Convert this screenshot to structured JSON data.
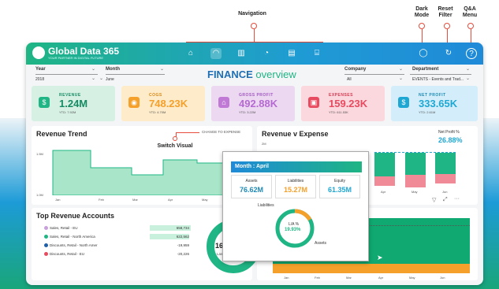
{
  "callouts": {
    "navigation": "Navigation",
    "dark_mode": "Dark Mode",
    "reset_filter": "Reset Filter",
    "qa_menu": "Q&A Menu",
    "switch_visual": "Switch Visual"
  },
  "brand": {
    "name": "Global Data 365",
    "tagline": "YOUR PARTNER IN DIGITAL FUTURE"
  },
  "colors": {
    "green": "#1fb584",
    "blue": "#1f8ad8",
    "orange": "#f5a02b"
  },
  "nav_icons": [
    "home-icon",
    "gauge-icon",
    "bar-chart-icon",
    "pie-chart-icon",
    "grid-icon",
    "bank-icon"
  ],
  "top_right_icons": [
    "bulb-icon",
    "refresh-icon",
    "question-icon"
  ],
  "filters": {
    "year": {
      "label": "Year",
      "value": "2018"
    },
    "month": {
      "label": "Month",
      "value": "June"
    },
    "company": {
      "label": "Company",
      "value": "All"
    },
    "department": {
      "label": "Department",
      "value": "EVENTS - Events and Trad..."
    }
  },
  "title": {
    "part1": "FINANCE",
    "part2": "overview"
  },
  "kpis": [
    {
      "title": "REVENUE",
      "value": "1.24M",
      "ytd": "YTD: 7.92M",
      "icon": "money-bag-icon"
    },
    {
      "title": "COGS",
      "value": "748.23K",
      "ytd": "YTD: 4.70M",
      "icon": "coin-icon"
    },
    {
      "title": "GROSS PROFIT",
      "value": "492.88K",
      "ytd": "YTD: 3.22M",
      "icon": "home-money-icon"
    },
    {
      "title": "EXPENSES",
      "value": "159.23K",
      "ytd": "YTD: 611.53K",
      "icon": "wallet-icon"
    },
    {
      "title": "NET PROFIT",
      "value": "333.65K",
      "ytd": "YTD: 2.61M",
      "icon": "dollar-icon"
    }
  ],
  "revenue_trend": {
    "title": "Revenue Trend",
    "change_link": "CHANGE TO EXPENSE",
    "y_ticks": [
      "1.5M",
      "1.0M"
    ],
    "x_ticks": [
      "Jan",
      "Feb",
      "Mar",
      "Apr",
      "May"
    ]
  },
  "rev_expense": {
    "title": "Revenue v Expense",
    "y_tick": "2M",
    "net_profit_label": "Net Profit %",
    "net_profit_value": "26.88%",
    "x_ticks": [
      "Apr",
      "May",
      "Jun"
    ]
  },
  "top_accounts": {
    "title": "Top Revenue Accounts",
    "rows": [
      {
        "name": "Sales, Retail - EU",
        "value": "658,734",
        "color": "#c9a0dc"
      },
      {
        "name": "Sales, Retail - North America",
        "value": "622,562",
        "color": "#1fb584"
      },
      {
        "name": "Discounts, Retail - North Amer",
        "value": "-19,959",
        "color": "#1f5fa8"
      },
      {
        "name": "Discounts, Retail - EU",
        "value": "-20,226",
        "color": "#e84a5f"
      }
    ],
    "donut_value": "16.30M",
    "donut_sub": "Last 12 Mon"
  },
  "bottom_chart": {
    "x_ticks": [
      "Jan",
      "Feb",
      "Mar",
      "Apr",
      "May",
      "Jun"
    ]
  },
  "tooltip": {
    "header": "Month : April",
    "assets_label": "Assets",
    "assets_value": "76.62M",
    "liab_label": "Liabilities",
    "liab_value": "15.27M",
    "equity_label": "Equity",
    "equity_value": "61.35M",
    "ring_label": "L/A %",
    "ring_value": "19.93%",
    "ring_liab": "Liabilities",
    "ring_assets": "Assets"
  }
}
